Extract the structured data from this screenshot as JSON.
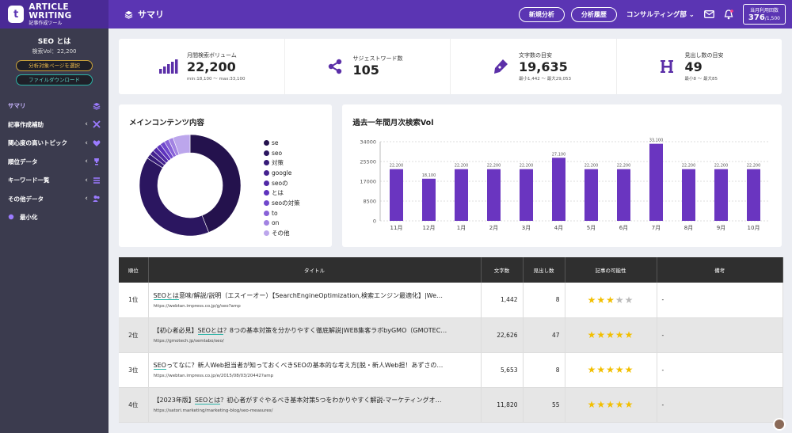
{
  "app": {
    "title": "ARTICLE WRITING",
    "subtitle": "記事作成ツール"
  },
  "page": {
    "title": "サマリ"
  },
  "topbar": {
    "new_analysis": "新規分析",
    "history": "分析履歴",
    "department": "コンサルティング部",
    "usage_label": "当月利用回数",
    "usage_value": "376",
    "usage_total": "/1,500"
  },
  "sidebar": {
    "keyword": "SEO とは",
    "volume": "検索Vol：22,200",
    "select_page": "分析対象ページを選択",
    "download": "ファイルダウンロード",
    "items": [
      {
        "label": "サマリ"
      },
      {
        "label": "記事作成補助"
      },
      {
        "label": "関心度の高いトピック"
      },
      {
        "label": "順位データ"
      },
      {
        "label": "キーワード一覧"
      },
      {
        "label": "その他データ"
      },
      {
        "label": "最小化"
      }
    ]
  },
  "cards": [
    {
      "label": "月間検索ボリューム",
      "value": "22,200",
      "sub": "min:18,100 〜 max:33,100",
      "icon": "signal-bars-icon"
    },
    {
      "label": "サジェストワード数",
      "value": "105",
      "sub": "",
      "icon": "share-icon"
    },
    {
      "label": "文字数の目安",
      "value": "19,635",
      "sub": "最小1,442 〜 最大29,053",
      "icon": "pen-icon"
    },
    {
      "label": "見出し数の目安",
      "value": "49",
      "sub": "最小8 〜 最大85",
      "icon": "heading-icon"
    }
  ],
  "donut": {
    "title": "メインコンテンツ内容",
    "legend": [
      {
        "name": "se",
        "color": "#24124d"
      },
      {
        "name": "seo",
        "color": "#2b1660"
      },
      {
        "name": "対策",
        "color": "#361b78"
      },
      {
        "name": "google",
        "color": "#44228f"
      },
      {
        "name": "seoの",
        "color": "#5029a6"
      },
      {
        "name": "とは",
        "color": "#5e33bd"
      },
      {
        "name": "seoの対策",
        "color": "#7048cc"
      },
      {
        "name": "to",
        "color": "#8862d8"
      },
      {
        "name": "on",
        "color": "#a283e2"
      },
      {
        "name": "その他",
        "color": "#bca6ec"
      }
    ]
  },
  "bar": {
    "title": "過去一年間月次検索Vol"
  },
  "chart_data": [
    {
      "type": "pie",
      "title": "メインコンテンツ内容",
      "labels": [
        "se",
        "seo",
        "対策",
        "google",
        "seoの",
        "とは",
        "seoの対策",
        "to",
        "on",
        "その他"
      ],
      "values": [
        44,
        40,
        1.5,
        1.5,
        1.5,
        1.5,
        1.5,
        1.5,
        1.5,
        5.5
      ]
    },
    {
      "type": "bar",
      "title": "過去一年間月次検索Vol",
      "categories": [
        "11月",
        "12月",
        "1月",
        "2月",
        "3月",
        "4月",
        "5月",
        "6月",
        "7月",
        "8月",
        "9月",
        "10月"
      ],
      "values": [
        22200,
        18100,
        22200,
        22200,
        22200,
        27100,
        22200,
        22200,
        33100,
        22200,
        22200,
        22200
      ],
      "value_labels": [
        "22,200",
        "18,100",
        "22,200",
        "22,200",
        "22,200",
        "27,100",
        "22,200",
        "22,200",
        "33,100",
        "22,200",
        "22,200",
        "22,200"
      ],
      "yticks": [
        "0",
        "8500",
        "17000",
        "25500",
        "34000"
      ],
      "ylim": [
        0,
        34000
      ],
      "color": "#6a35c0"
    }
  ],
  "table": {
    "headers": [
      "順位",
      "タイトル",
      "文字数",
      "見出し数",
      "記事の可能性",
      "備考"
    ],
    "rows": [
      {
        "rank": "1位",
        "title_pre": "",
        "title_hl": "SEOとは",
        "title_post": "意味/解説/説明（エスイーオー）【SearchEngineOptimization,検索エンジン最適化】|We…",
        "url": "https://webtan.impress.co.jp/g/seo?amp",
        "chars": "1,442",
        "heads": "8",
        "stars": 3,
        "note": "-"
      },
      {
        "rank": "2位",
        "title_pre": "【初心者必見】",
        "title_hl": "SEOとは",
        "title_post": "？8つの基本対策を分かりやすく徹底解説|WEB集客ラボbyGMO（GMOTEC…",
        "url": "https://gmotech.jp/semlabo/seo/",
        "chars": "22,626",
        "heads": "47",
        "stars": 5,
        "note": "-"
      },
      {
        "rank": "3位",
        "title_pre": "",
        "title_hl": "SEO",
        "title_post": "ってなに？新人Web担当者が知っておくべきSEOの基本的な考え方[脱・新人Web担！あずさの…",
        "url": "https://webtan.impress.co.jp/e/2015/08/03/20442?amp",
        "chars": "5,653",
        "heads": "8",
        "stars": 5,
        "note": "-"
      },
      {
        "rank": "4位",
        "title_pre": "【2023年版】",
        "title_hl": "SEOとは",
        "title_post": "？初心者がすぐやるべき基本対策5つをわかりやすく解説-マーケティングオ…",
        "url": "https://satori.marketing/marketing-blog/seo-measures/",
        "chars": "11,820",
        "heads": "55",
        "stars": 5,
        "note": "-"
      }
    ]
  }
}
